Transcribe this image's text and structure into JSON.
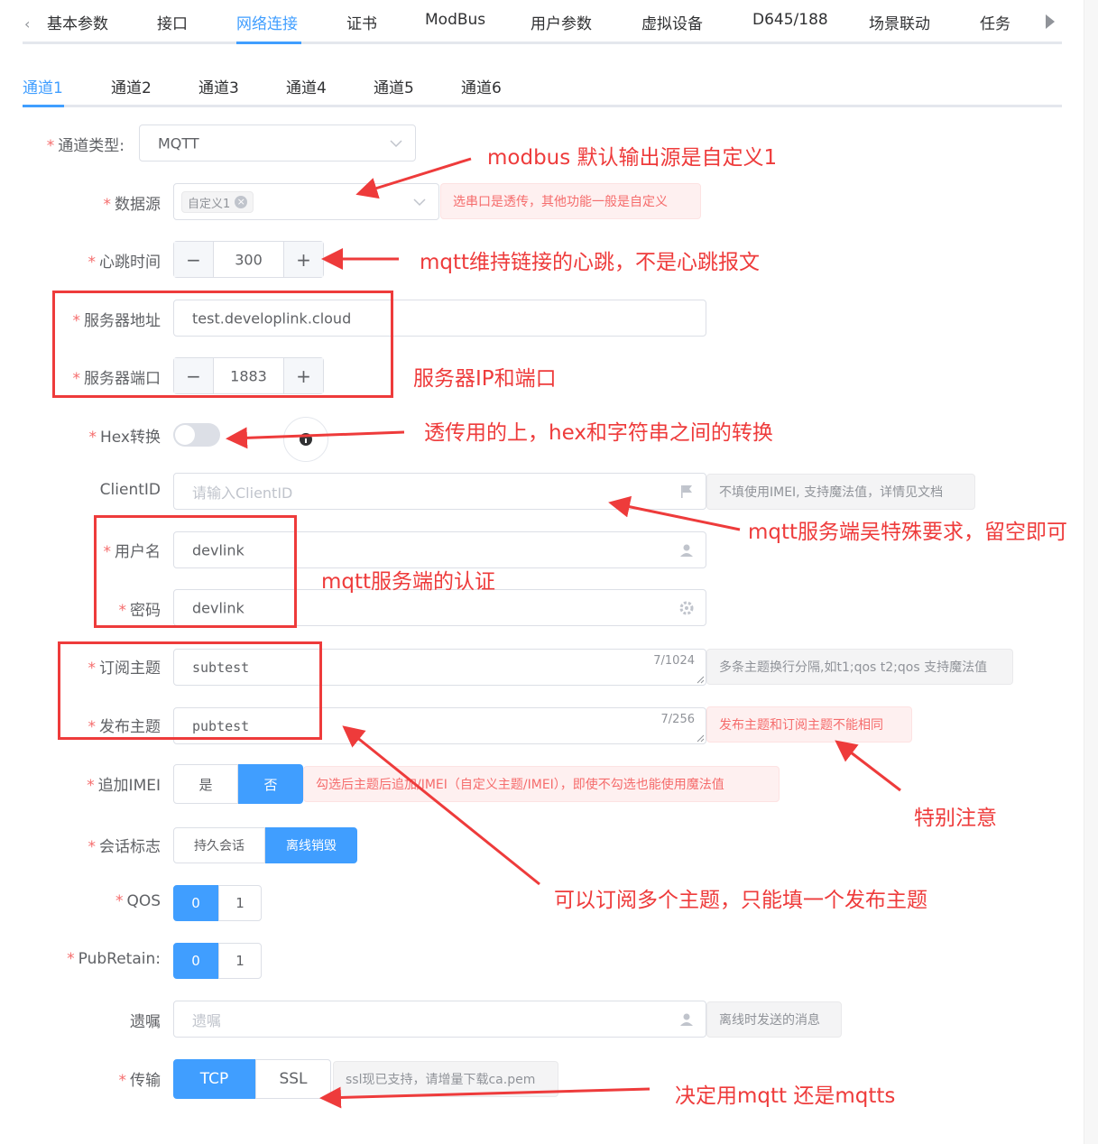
{
  "top_tabs": [
    "基本参数",
    "接口",
    "网络连接",
    "证书",
    "ModBus",
    "用户参数",
    "虚拟设备",
    "D645/188",
    "场景联动",
    "任务"
  ],
  "active_top_tab": "网络连接",
  "sub_tabs": [
    "通道1",
    "通道2",
    "通道3",
    "通道4",
    "通道5",
    "通道6"
  ],
  "form": {
    "channel_type": {
      "label": "通道类型:",
      "value": "MQTT"
    },
    "data_source": {
      "label": "数据源",
      "tag": "自定义1",
      "tip": "选串口是透传，其他功能一般是自定义"
    },
    "heartbeat": {
      "label": "心跳时间",
      "value": "300"
    },
    "server_addr": {
      "label": "服务器地址",
      "value": "test.developlink.cloud"
    },
    "server_port": {
      "label": "服务器端口",
      "value": "1883"
    },
    "hex": {
      "label": "Hex转换"
    },
    "client_id": {
      "label": "ClientID",
      "placeholder": "请输入ClientID",
      "tip": "不填使用IMEI, 支持魔法值，详情见文档"
    },
    "username": {
      "label": "用户名",
      "value": "devlink"
    },
    "password": {
      "label": "密码",
      "value": "devlink"
    },
    "sub_topic": {
      "label": "订阅主题",
      "value": "subtest",
      "count": "7/1024",
      "tip": "多条主题换行分隔,如t1;qos t2;qos 支持魔法值"
    },
    "pub_topic": {
      "label": "发布主题",
      "value": "pubtest",
      "count": "7/256",
      "tip": "发布主题和订阅主题不能相同"
    },
    "append_imei": {
      "label": "追加IMEI",
      "options": [
        "是",
        "否"
      ],
      "selected": "否",
      "tip": "勾选后主题后追加/IMEI（自定义主题/IMEI），即使不勾选也能使用魔法值"
    },
    "session": {
      "label": "会话标志",
      "options": [
        "持久会话",
        "离线销毁"
      ],
      "selected": "离线销毁"
    },
    "qos": {
      "label": "QOS",
      "options": [
        "0",
        "1"
      ],
      "selected": "0"
    },
    "pub_retain": {
      "label": "PubRetain:",
      "options": [
        "0",
        "1"
      ],
      "selected": "0"
    },
    "will": {
      "label": "遗嘱",
      "placeholder": "遗嘱",
      "tip": "离线时发送的消息"
    },
    "transport": {
      "label": "传输",
      "options": [
        "TCP",
        "SSL"
      ],
      "selected": "TCP",
      "tip": "ssl现已支持，请增量下载ca.pem"
    }
  },
  "annotations": {
    "a1": "modbus 默认输出源是自定义1",
    "a2": "mqtt维持链接的心跳，不是心跳报文",
    "a3": "服务器IP和端口",
    "a4": "透传用的上，hex和字符串之间的转换",
    "a5": "mqtt服务端吴特殊要求，留空即可",
    "a6": "mqtt服务端的认证",
    "a7": "特别注意",
    "a8": "可以订阅多个主题，只能填一个发布主题",
    "a9": "决定用mqtt 还是mqtts"
  },
  "colors": {
    "primary": "#409eff",
    "annotation": "#ee3b3b",
    "error": "#f56c6c"
  }
}
